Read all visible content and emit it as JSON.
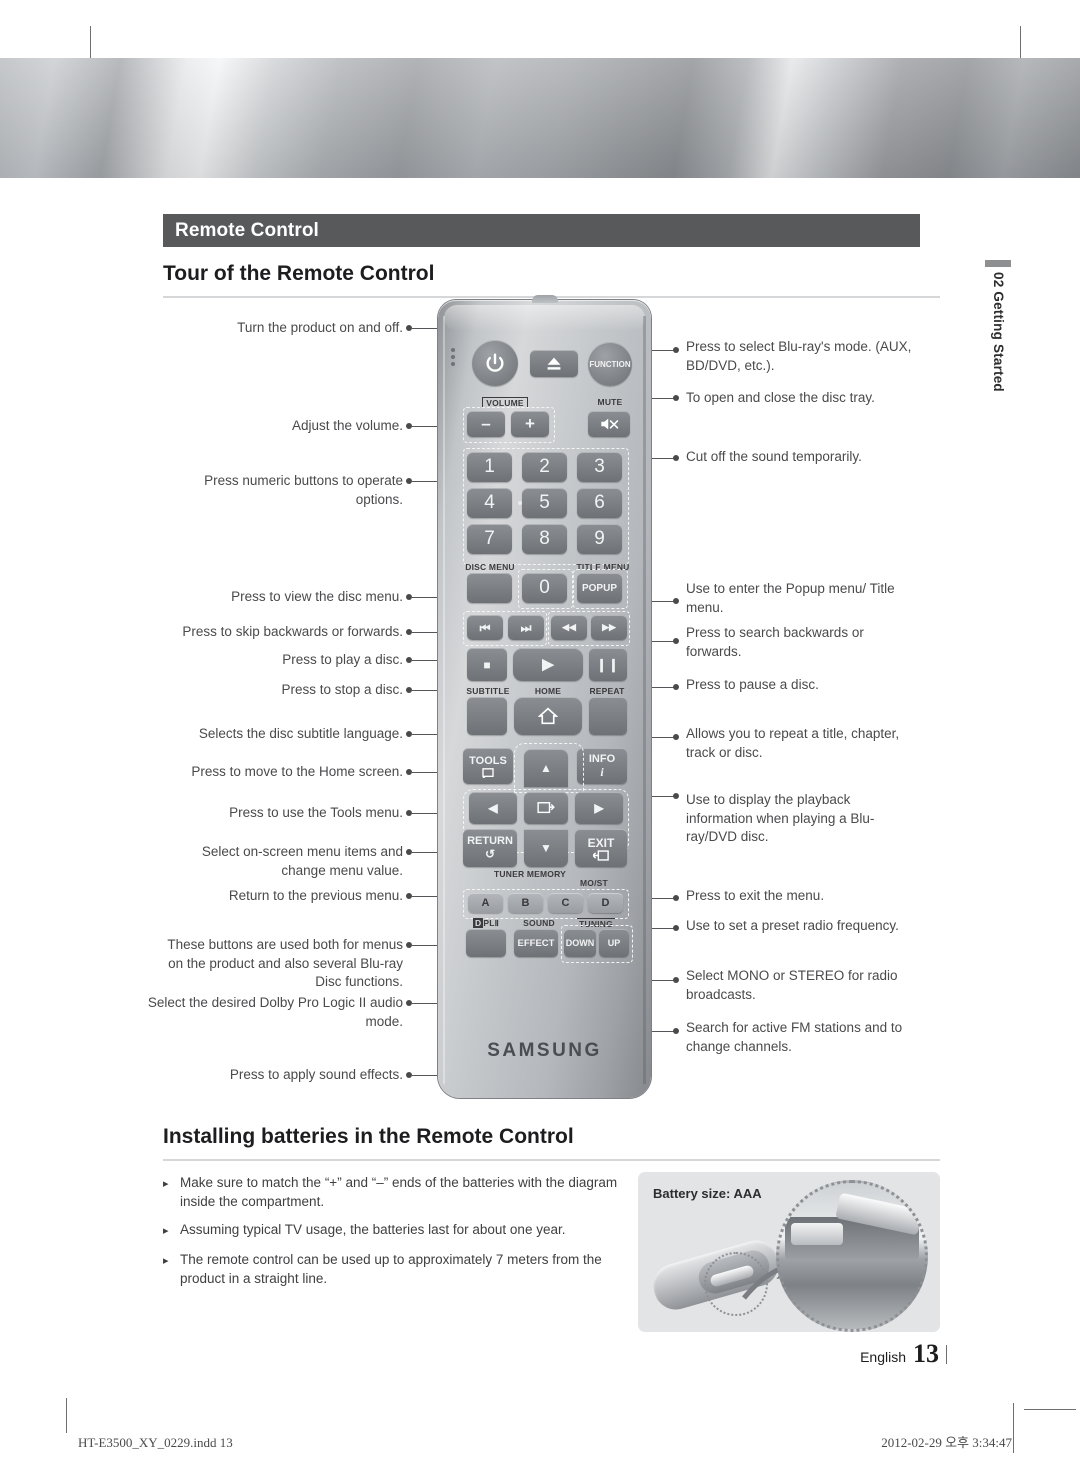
{
  "document": {
    "section_banner": "Remote Control",
    "heading_tour": "Tour of the Remote Control",
    "heading_batteries": "Installing batteries in the Remote Control",
    "side_tab": "02  Getting Started",
    "page_language": "English",
    "page_number": "13",
    "print_file": "HT-E3500_XY_0229.indd   13",
    "print_date": "2012-02-29   오후 3:34:47"
  },
  "callouts_left": [
    {
      "id": "power",
      "text": "Turn the product on and off."
    },
    {
      "id": "volume",
      "text": "Adjust the volume."
    },
    {
      "id": "numeric",
      "text": "Press numeric buttons to operate options."
    },
    {
      "id": "disc-menu",
      "text": "Press to view the disc menu."
    },
    {
      "id": "skip",
      "text": "Press to skip backwards or forwards."
    },
    {
      "id": "play",
      "text": "Press to play a disc."
    },
    {
      "id": "stop",
      "text": "Press to stop a disc."
    },
    {
      "id": "subtitle",
      "text": "Selects the disc subtitle language."
    },
    {
      "id": "home",
      "text": "Press to move to the Home screen."
    },
    {
      "id": "tools",
      "text": "Press to use the Tools menu."
    },
    {
      "id": "arrows",
      "text": "Select on-screen menu items and change menu value."
    },
    {
      "id": "return",
      "text": "Return to the previous menu."
    },
    {
      "id": "abcd",
      "text": "These buttons are used both for menus on the product and also several Blu-ray Disc functions."
    },
    {
      "id": "dolby",
      "text": "Select the desired Dolby Pro Logic II audio mode."
    },
    {
      "id": "effect",
      "text": "Press to apply sound effects."
    }
  ],
  "callouts_right": [
    {
      "id": "function",
      "text": "Press to select Blu-ray's mode. (AUX, BD/DVD, etc.)."
    },
    {
      "id": "eject",
      "text": "To open and close the disc tray."
    },
    {
      "id": "mute",
      "text": "Cut off the sound temporarily."
    },
    {
      "id": "popup",
      "text": "Use to enter the Popup menu/ Title menu."
    },
    {
      "id": "search",
      "text": "Press to search backwards or forwards."
    },
    {
      "id": "pause",
      "text": "Press to pause a disc."
    },
    {
      "id": "repeat",
      "text": "Allows you to repeat a title, chapter, track or disc."
    },
    {
      "id": "info",
      "text": "Use to display the playback information when playing a Blu-ray/DVD disc."
    },
    {
      "id": "exit",
      "text": "Press to exit the menu."
    },
    {
      "id": "tuner",
      "text": "Use to set a preset radio frequency."
    },
    {
      "id": "most",
      "text": "Select MONO or STEREO for radio broadcasts."
    },
    {
      "id": "tuning",
      "text": "Search for active FM stations and to change channels."
    }
  ],
  "remote": {
    "brand": "SAMSUNG",
    "labels": {
      "function": "FUNCTION",
      "volume": "VOLUME",
      "mute": "MUTE",
      "disc_menu": "DISC MENU",
      "title_menu": "TITLE MENU",
      "popup": "POPUP",
      "subtitle": "SUBTITLE",
      "home": "HOME",
      "repeat": "REPEAT",
      "tools": "TOOLS",
      "info": "INFO",
      "return": "RETURN",
      "exit": "EXIT",
      "tuner_memory": "TUNER MEMORY",
      "most": "MO/ST",
      "tuning": "TUNING",
      "dolby": "PL",
      "sound": "SOUND",
      "effect": "EFFECT",
      "down": "DOWN",
      "up": "UP"
    },
    "numbers": [
      "1",
      "2",
      "3",
      "4",
      "5",
      "6",
      "7",
      "8",
      "9",
      "0"
    ],
    "volume_minus": "–",
    "volume_plus": "+",
    "color_keys": [
      "A",
      "B",
      "C",
      "D"
    ],
    "glyphs": {
      "power": "power-icon",
      "eject": "eject-icon",
      "mute": "mute-icon",
      "skip_back": "⏮",
      "skip_fwd": "⏭",
      "rew": "◀◀",
      "ff": "▶▶",
      "stop": "■",
      "play": "▶",
      "pause": "❙❙",
      "home": "home-icon",
      "up": "▲",
      "down": "▼",
      "left": "◀",
      "right": "▶",
      "enter": "enter-icon",
      "return": "↺",
      "exit": "exit-icon",
      "info": "i"
    }
  },
  "batteries": {
    "panel_caption": "Battery size: AAA",
    "bullets": [
      "Make sure to match the “+” and “–” ends of the batteries with the diagram inside the compartment.",
      "Assuming typical TV usage, the batteries last for about one year.",
      "The remote control can be used up to approximately 7 meters from the product in a straight line."
    ],
    "bullet_marker": "▸"
  },
  "colors": {
    "banner_bg": "#58595b",
    "text": "#3f3f41",
    "heading": "#1d1d1f",
    "panel_bg": "#e3e4e6"
  }
}
